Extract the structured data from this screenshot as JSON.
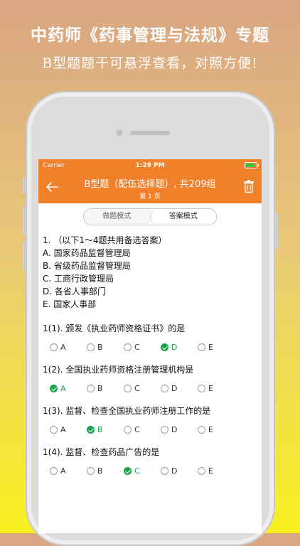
{
  "promo": {
    "line1": "中药师《药事管理与法规》专题",
    "line2": "B型题题干可悬浮查看，对照方便!"
  },
  "status": {
    "carrier": "Carrier",
    "time": "1:29 PM"
  },
  "header": {
    "title": "B型题（配伍选择题）, 共209组",
    "subtitle": "第 1 页"
  },
  "segment": {
    "practice": "做题模式",
    "answer": "答案模式"
  },
  "question": {
    "stem": "1. （以下1～4题共用备选答案）",
    "options": [
      "A. 国家药品监督管理局",
      "B. 省级药品监督管理局",
      "C. 工商行政管理局",
      "D. 各省人事部门",
      "E. 国家人事部"
    ]
  },
  "choice_letters": [
    "A",
    "B",
    "C",
    "D",
    "E"
  ],
  "sub_questions": [
    {
      "text": "1(1). 颁发《执业药师资格证书》的是",
      "answer": "D"
    },
    {
      "text": "1(2). 全国执业药师资格注册管理机构是",
      "answer": "A"
    },
    {
      "text": "1(3). 监督、检查全国执业药师注册工作的是",
      "answer": "B"
    },
    {
      "text": "1(4). 监督、检查药品广告的是",
      "answer": "C"
    }
  ],
  "colors": {
    "accent": "#f0802a",
    "correct": "#1aa34a"
  }
}
